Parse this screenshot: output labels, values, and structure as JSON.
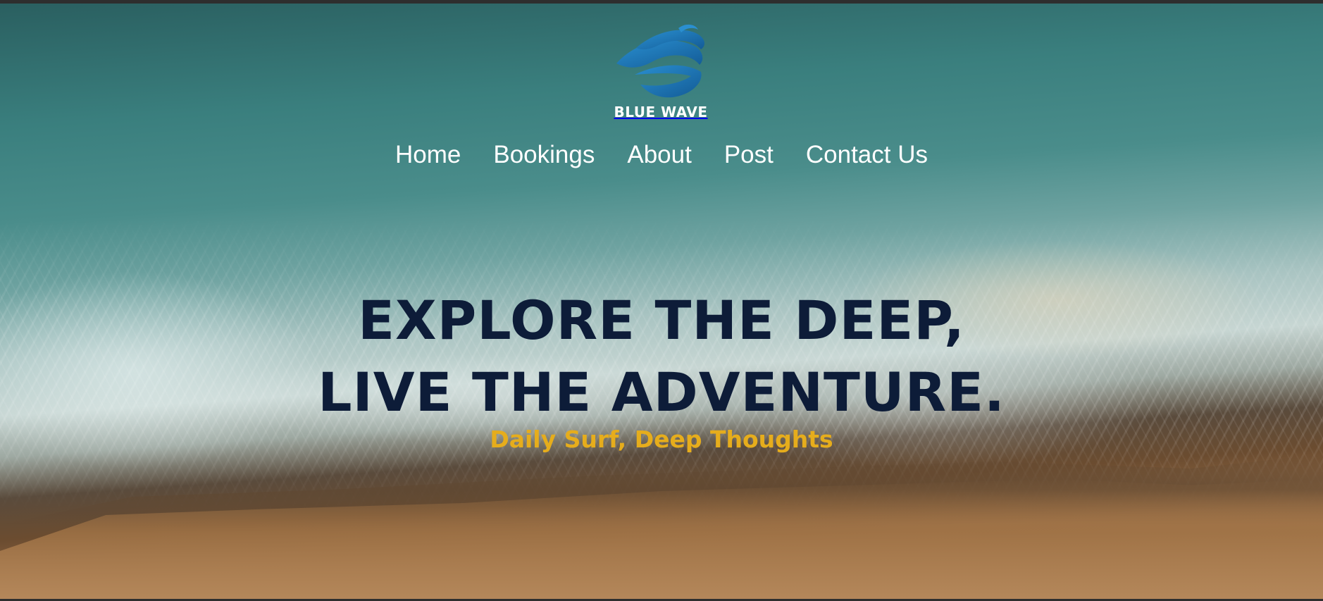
{
  "brand": {
    "name": "BLUE WAVE",
    "logo_icon": "wave-logo-icon",
    "logo_color": "#1f77b4"
  },
  "nav": {
    "items": [
      {
        "label": "Home"
      },
      {
        "label": "Bookings"
      },
      {
        "label": "About"
      },
      {
        "label": "Post"
      },
      {
        "label": "Contact Us"
      }
    ]
  },
  "hero": {
    "headline_line1": "EXPLORE THE DEEP,",
    "headline_line2": "LIVE THE ADVENTURE.",
    "tagline": "Daily Surf, Deep Thoughts",
    "headline_color": "#0d1c38",
    "tagline_color": "#e6ad1c"
  }
}
